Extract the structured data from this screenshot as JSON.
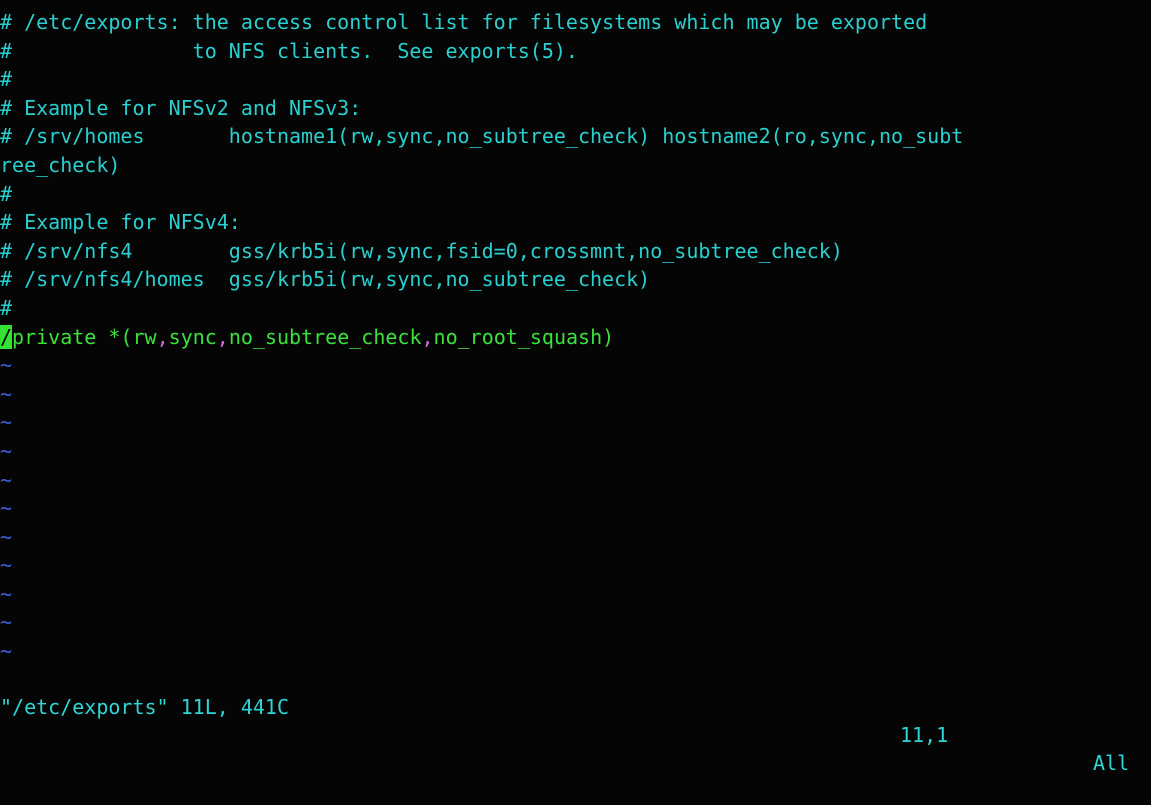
{
  "editor": {
    "buffer_lines": [
      {
        "kind": "comment",
        "text": "# /etc/exports: the access control list for filesystems which may be exported"
      },
      {
        "kind": "comment",
        "text": "#               to NFS clients.  See exports(5)."
      },
      {
        "kind": "comment",
        "text": "#"
      },
      {
        "kind": "comment",
        "text": "# Example for NFSv2 and NFSv3:"
      },
      {
        "kind": "comment",
        "text": "# /srv/homes       hostname1(rw,sync,no_subtree_check) hostname2(ro,sync,no_subt"
      },
      {
        "kind": "comment",
        "text": "ree_check)"
      },
      {
        "kind": "comment",
        "text": "#"
      },
      {
        "kind": "comment",
        "text": "# Example for NFSv4:"
      },
      {
        "kind": "comment",
        "text": "# /srv/nfs4        gss/krb5i(rw,sync,fsid=0,crossmnt,no_subtree_check)"
      },
      {
        "kind": "comment",
        "text": "# /srv/nfs4/homes  gss/krb5i(rw,sync,no_subtree_check)"
      },
      {
        "kind": "comment",
        "text": "#"
      }
    ],
    "active_line": {
      "cursor_char": "/",
      "path_rest": "private",
      "space": " ",
      "opt_open": "*(rw",
      "comma1": ",",
      "opt_sync": "sync",
      "comma2": ",",
      "opt_nosubtree": "no_subtree_check",
      "comma3": ",",
      "opt_noroot": "no_root_squash)"
    },
    "empty_line_marker": "~",
    "empty_line_count": 11
  },
  "statusbar": {
    "file_info": "\"/etc/exports\" 11L, 441C",
    "cursor_position": "11,1",
    "scroll_position": "All"
  },
  "colors": {
    "background": "#050505",
    "comment": "#2ad0d0",
    "code": "#3be23b",
    "separator": "#d66ad6",
    "tilde": "#3c5fd8",
    "cursor": "#34e234"
  }
}
